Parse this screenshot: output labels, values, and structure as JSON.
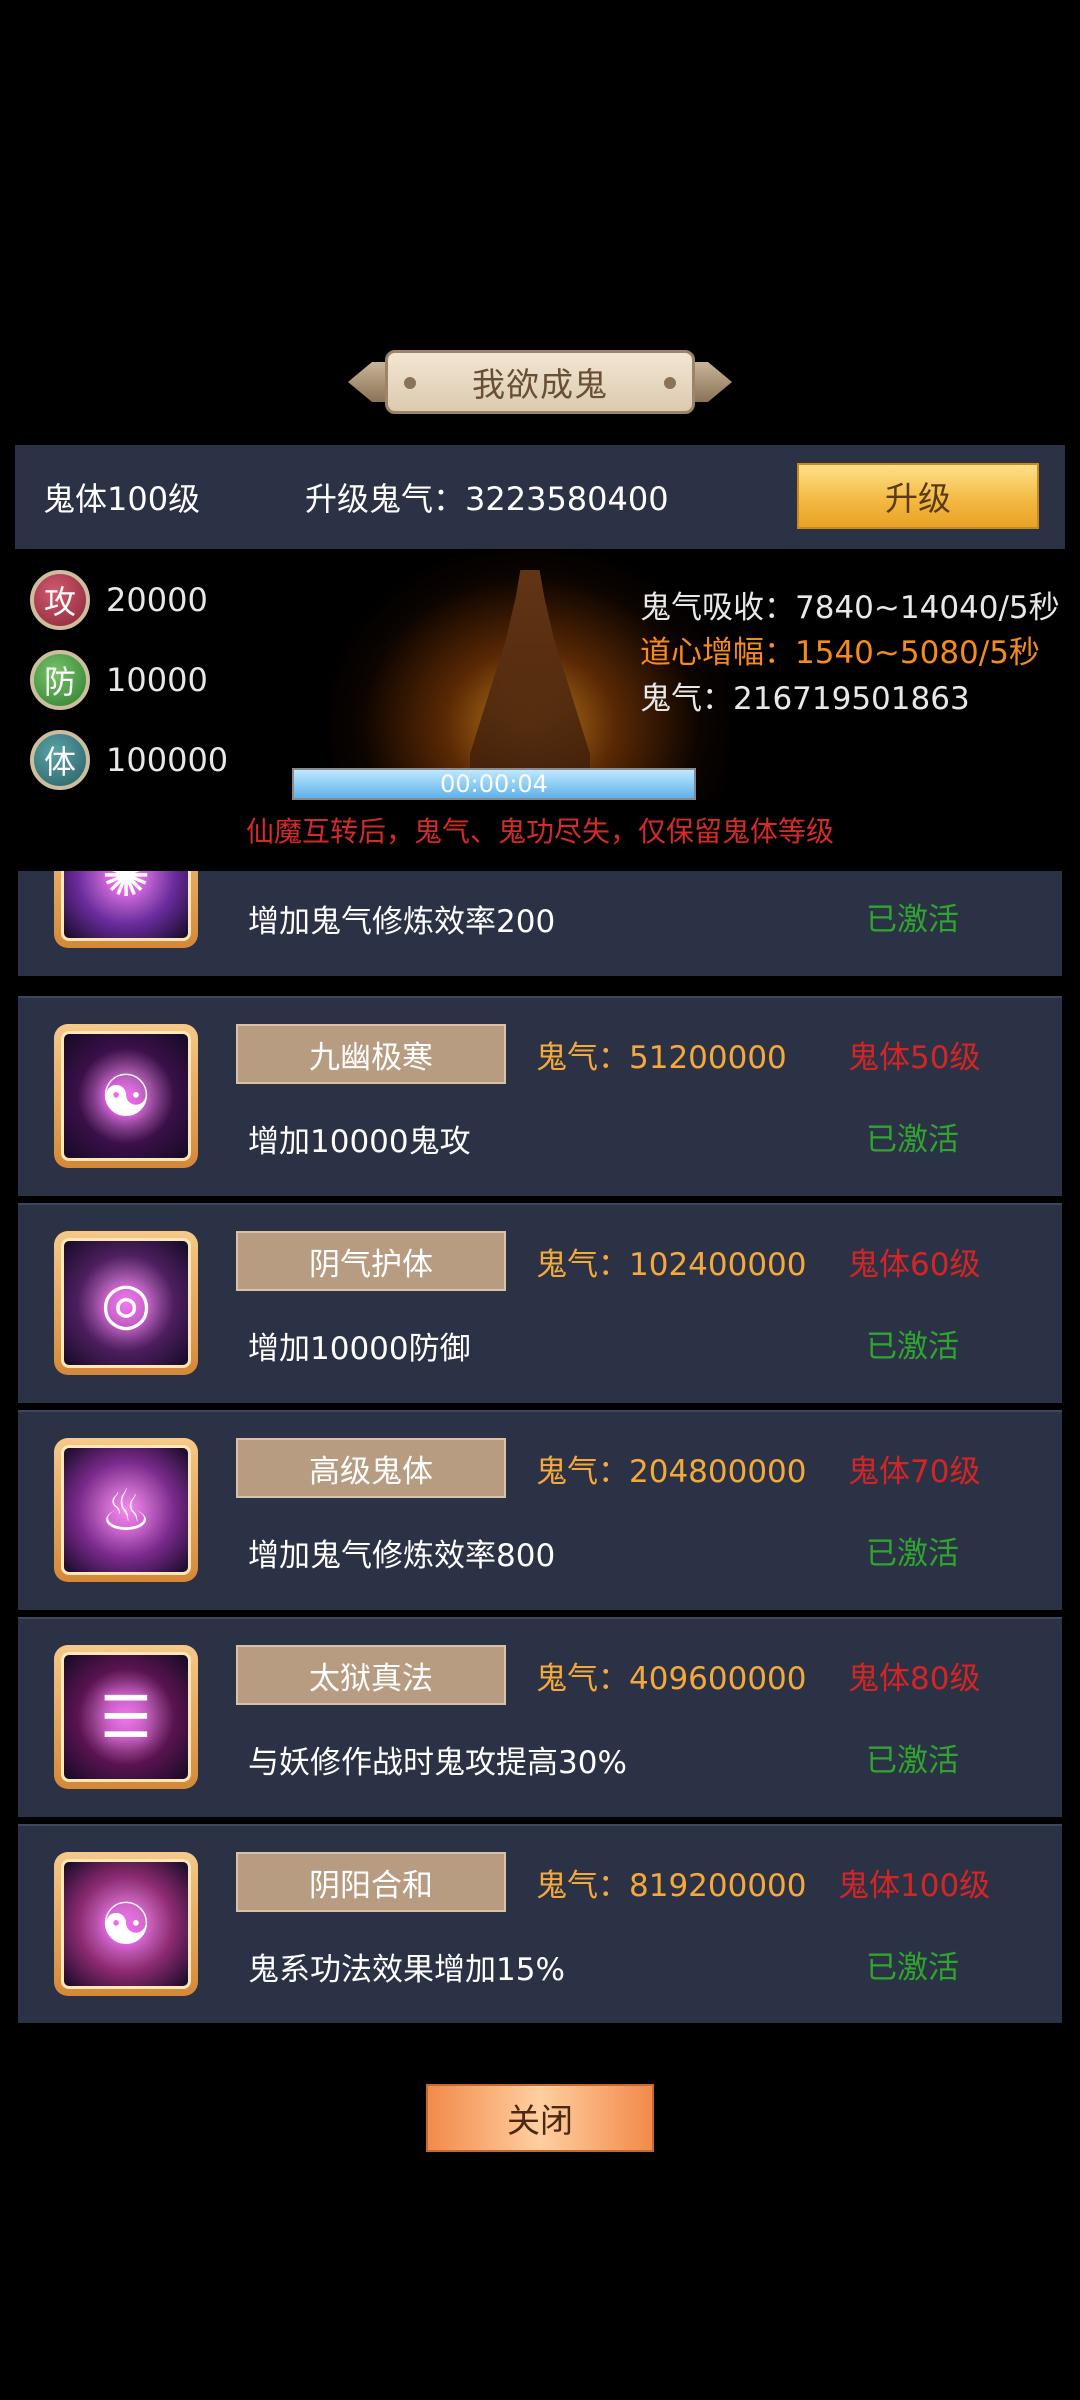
{
  "title": "我欲成鬼",
  "upgrade": {
    "level_text": "鬼体100级",
    "cost_text": "升级鬼气：3223580400",
    "button_label": "升级"
  },
  "stats": [
    {
      "badge": "攻",
      "value": "20000"
    },
    {
      "badge": "防",
      "value": "10000"
    },
    {
      "badge": "体",
      "value": "100000"
    }
  ],
  "info": {
    "absorb": "鬼气吸收：7840~14040/5秒",
    "boost": "道心增幅：1540~5080/5秒",
    "total": "鬼气：216719501863"
  },
  "timer": {
    "text": "00:00:04",
    "progress_percent": 100
  },
  "warning": "仙魔互转后，鬼气、鬼功尽失，仅保留鬼体等级",
  "skills": [
    {
      "name": "",
      "cost": "",
      "req": "",
      "desc": "增加鬼气修炼效率200",
      "status": "已激活",
      "icon": "vortex-icon",
      "glyph": "✺",
      "color": "#6b2c9e"
    },
    {
      "name": "九幽极寒",
      "cost": "鬼气：51200000",
      "req": "鬼体50级",
      "desc": "增加10000鬼攻",
      "status": "已激活",
      "icon": "yin-yang-icon",
      "glyph": "☯",
      "color": "#3a1048"
    },
    {
      "name": "阴气护体",
      "cost": "鬼气：102400000",
      "req": "鬼体60级",
      "desc": "增加10000防御",
      "status": "已激活",
      "icon": "shield-ring-icon",
      "glyph": "◎",
      "color": "#4d1f5f"
    },
    {
      "name": "高级鬼体",
      "cost": "鬼气：204800000",
      "req": "鬼体70级",
      "desc": "增加鬼气修炼效率800",
      "status": "已激活",
      "icon": "ghost-body-icon",
      "glyph": "♨",
      "color": "#7a2a8c"
    },
    {
      "name": "太狱真法",
      "cost": "鬼气：409600000",
      "req": "鬼体80级",
      "desc": "与妖修作战时鬼攻提高30%",
      "status": "已激活",
      "icon": "bagua-icon",
      "glyph": "☰",
      "color": "#5a1450"
    },
    {
      "name": "阴阳合和",
      "cost": "鬼气：819200000",
      "req": "鬼体100级",
      "desc": "鬼系功法效果增加15%",
      "status": "已激活",
      "icon": "yin-yang-orb-icon",
      "glyph": "☯",
      "color": "#8a2a70"
    }
  ],
  "close_label": "关闭"
}
